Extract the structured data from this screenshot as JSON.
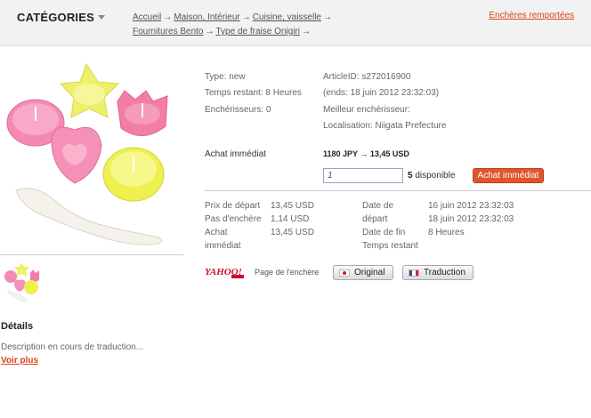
{
  "header": {
    "categories_label": "CATÉGORIES",
    "breadcrumbs": [
      {
        "label": "Accueil"
      },
      {
        "label": "Maison, Intérieur"
      },
      {
        "label": "Cuisine, vaisselle"
      },
      {
        "label": "Fournitures Bento"
      },
      {
        "label": "Type de fraise Onigiri"
      }
    ],
    "breadcrumb_separator": "→",
    "ended_link": "Enchères remportées"
  },
  "item": {
    "type": "Type: new",
    "time_left": "Temps restant: 8 Heures",
    "bidders": "Enchérisseurs: 0",
    "article_id": "ArticleID: s272016900",
    "ends": "(ends: 18 juin 2012 23:32:03)",
    "best_bidder": "Meilleur enchérisseur:",
    "location": "Localisation: Niigata Prefecture"
  },
  "buy": {
    "label": "Achat immédiat",
    "price": "1180 JPY → 13,45 USD",
    "quantity_value": "1",
    "available_count": "5",
    "available_text": " disponible",
    "button_label": "Achat immédiat"
  },
  "details_left": {
    "labels": [
      "Prix de départ",
      "Pas d'enchère",
      "Achat",
      "immédiat"
    ],
    "values": [
      "13,45 USD",
      "1,14 USD",
      "13,45 USD"
    ]
  },
  "details_right": {
    "labels": [
      "Date de",
      "départ",
      "Date de fin",
      "Temps restant"
    ],
    "values": [
      "16 juin 2012 23:32:03",
      "18 juin 2012 23:32:03",
      "8 Heures"
    ]
  },
  "auction_source": {
    "logo_text": "YAHOO!",
    "page_label": "Page de l'enchère",
    "original_button": "Original",
    "translation_button": "Traduction"
  },
  "details": {
    "heading": "Détails",
    "description": "Description en cours de traduction...",
    "more_link": "Voir plus"
  },
  "colors": {
    "accent": "#d8431b",
    "buy_button": "#e0552a",
    "input_border": "#8ea5c8"
  }
}
